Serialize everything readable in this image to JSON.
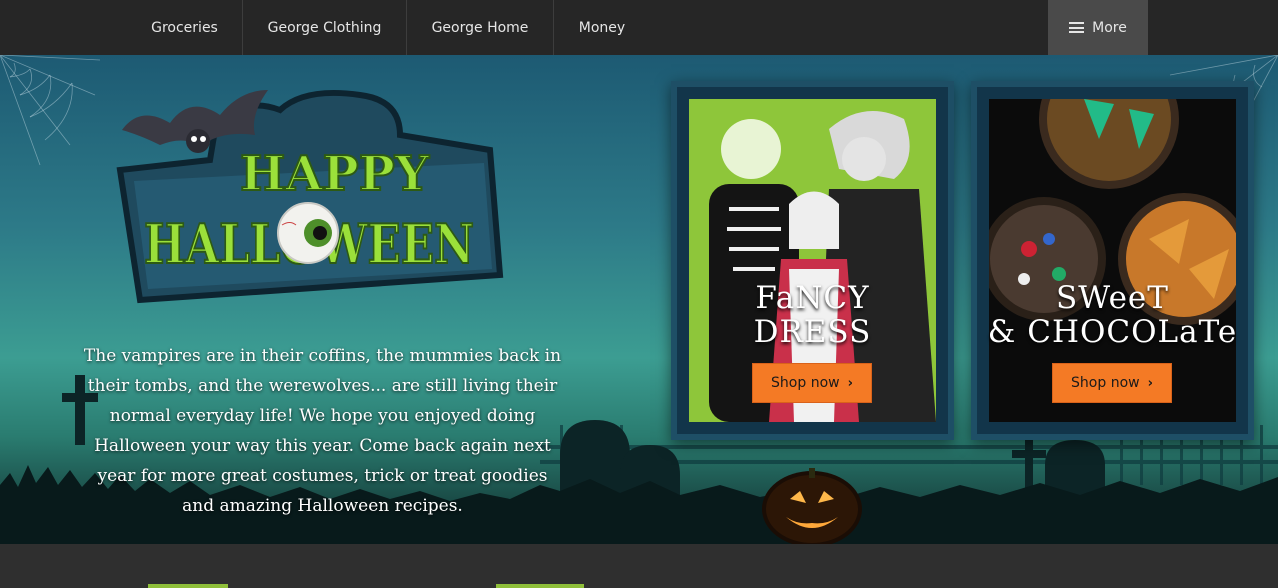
{
  "nav": {
    "items": [
      {
        "label": "Groceries"
      },
      {
        "label": "George Clothing"
      },
      {
        "label": "George Home"
      },
      {
        "label": "Money"
      }
    ],
    "more_label": "More"
  },
  "hero": {
    "logo_line1": "HAPPY",
    "logo_line2": "HALLOWEEN",
    "message": "The vampires are in their coffins, the mummies back in their tombs, and the werewolves... are still living their normal everyday life! We hope you enjoyed doing Halloween your way this year. Come back again next year for more great costumes, trick or treat goodies and amazing Halloween recipes."
  },
  "promos": [
    {
      "title_line1": "FaNCY",
      "title_line2": "DRESS",
      "button": "Shop now"
    },
    {
      "title_line1": "SWeeT",
      "title_line2": "& CHOCOLaTe",
      "button": "Shop now"
    }
  ],
  "colors": {
    "nav_bg": "#262626",
    "more_bg": "#4a4a4a",
    "button_orange": "#f47a25",
    "logo_green": "#9be03a",
    "frame_blue": "#12354a"
  },
  "icons": [
    "hamburger-icon",
    "chevron-right-icon",
    "bat-icon",
    "eyeball-icon",
    "pumpkin-icon"
  ]
}
